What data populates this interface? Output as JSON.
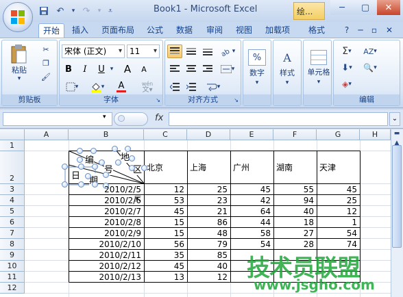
{
  "app": {
    "title": "Book1 - Microsoft Excel",
    "context_tab": "绘...",
    "accent": "#f3cf62",
    "brand": "#15428b"
  },
  "qat": {
    "save": "save-icon",
    "undo": "undo-icon",
    "redo": "redo-icon"
  },
  "tabs": [
    "开始",
    "插入",
    "页面布局",
    "公式",
    "数据",
    "审阅",
    "视图",
    "加载项",
    "格式"
  ],
  "ribbon": {
    "clipboard": {
      "label": "剪贴板",
      "paste": "粘贴"
    },
    "font": {
      "label": "字体",
      "name": "宋体 (正文)",
      "size": "11",
      "bold": "B",
      "italic": "I",
      "underline": "U",
      "grow": "A",
      "shrink": "A",
      "color_letter": "A",
      "wen": "wén"
    },
    "alignment": {
      "label": "对齐方式"
    },
    "number": {
      "label": "数字"
    },
    "styles": {
      "label": "样式"
    },
    "cells": {
      "label": "单元格"
    },
    "editing": {
      "label": "编辑"
    }
  },
  "formula": {
    "name_box": "",
    "fx": "fx",
    "value": ""
  },
  "sheet": {
    "columns": [
      "A",
      "B",
      "C",
      "D",
      "E",
      "F",
      "G",
      "H"
    ],
    "rows": [
      "1",
      "2",
      "3",
      "4",
      "5",
      "6",
      "7",
      "8",
      "9",
      "10",
      "11",
      "12"
    ],
    "headers": [
      "北京",
      "上海",
      "广州",
      "湖南",
      "天津"
    ],
    "diag_labels": {
      "bian": "编",
      "hao": "号",
      "di": "地",
      "qu": "区",
      "ri": "日",
      "qi": "期"
    },
    "data": [
      {
        "date": "2010/2/5",
        "v": [
          "12",
          "25",
          "45",
          "55",
          "45"
        ]
      },
      {
        "date": "2010/2/6",
        "v": [
          "53",
          "23",
          "42",
          "94",
          "25"
        ]
      },
      {
        "date": "2010/2/7",
        "v": [
          "45",
          "21",
          "64",
          "40",
          "12"
        ]
      },
      {
        "date": "2010/2/8",
        "v": [
          "15",
          "86",
          "44",
          "18",
          "1"
        ]
      },
      {
        "date": "2010/2/9",
        "v": [
          "15",
          "48",
          "58",
          "27",
          "54"
        ]
      },
      {
        "date": "2010/2/10",
        "v": [
          "56",
          "79",
          "54",
          "28",
          "74"
        ]
      },
      {
        "date": "2010/2/11",
        "v": [
          "35",
          "85",
          "",
          "",
          ""
        ]
      },
      {
        "date": "2010/2/12",
        "v": [
          "45",
          "40",
          "",
          "",
          ""
        ]
      },
      {
        "date": "2010/2/13",
        "v": [
          "13",
          "12",
          "",
          "",
          ""
        ]
      }
    ]
  },
  "watermark": {
    "text": "技术员联盟",
    "url": "www.jsgho.com"
  }
}
